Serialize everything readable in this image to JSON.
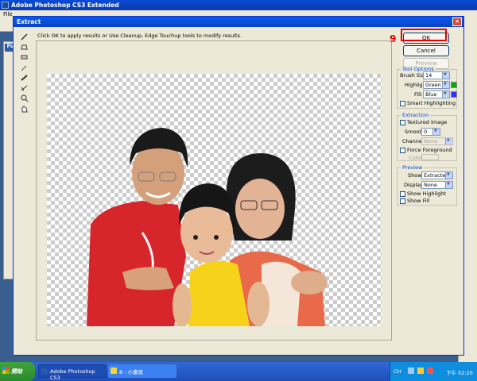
{
  "photoshop": {
    "title": "Adobe Photoshop CS3 Extended",
    "menu_first": "File",
    "badge": "Ps"
  },
  "dialog": {
    "title": "Extract",
    "close_glyph": "×",
    "instructions": "Click OK to apply results or Use Cleanup, Edge Touchup tools to modify results.",
    "ok_label": "OK",
    "cancel_label": "Cancel",
    "preview_label": "Preview",
    "tool_options": {
      "title": "Tool Options",
      "brush_size_label": "Brush Size:",
      "brush_size_value": "14",
      "highlight_label": "Highlight:",
      "highlight_value": "Green",
      "highlight_color": "#00b000",
      "fill_label": "Fill:",
      "fill_value": "Blue",
      "fill_color": "#3030ff",
      "smart_highlighting_label": "Smart Highlighting"
    },
    "extraction": {
      "title": "Extraction",
      "textured_image_label": "Textured Image",
      "smooth_label": "Smooth:",
      "smooth_value": "0",
      "channel_label": "Channel:",
      "channel_value": "None",
      "force_foreground_label": "Force Foreground",
      "color_label": "Color:"
    },
    "preview": {
      "title": "Preview",
      "show_label": "Show:",
      "show_value": "Extracted",
      "display_label": "Display:",
      "display_value": "None",
      "show_highlight_label": "Show Highlight",
      "show_fill_label": "Show Fill"
    }
  },
  "annotation": {
    "step_number": "9"
  },
  "taskbar": {
    "start_label": "開始",
    "task1_label": "Adobe Photoshop CS3",
    "task2_label": "8 - 小畫家",
    "lang": "CH",
    "clock": "下午 02:20"
  }
}
